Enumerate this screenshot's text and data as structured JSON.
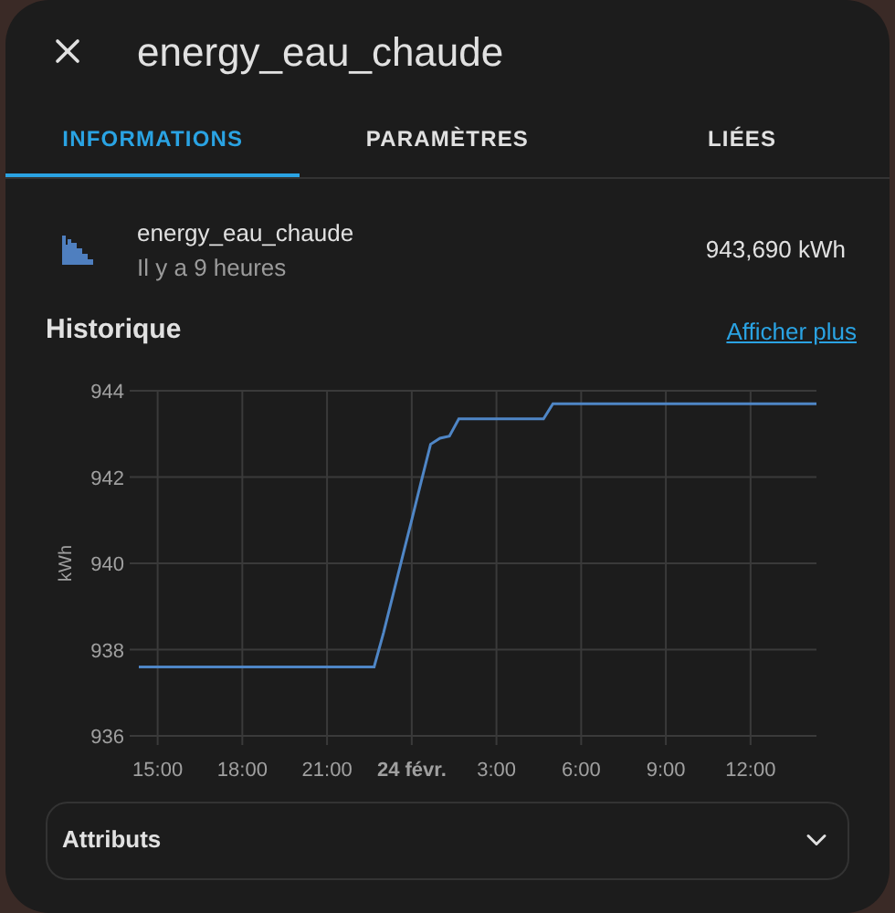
{
  "dialog": {
    "title": "energy_eau_chaude"
  },
  "tabs": [
    {
      "label": "INFORMATIONS",
      "selected": true
    },
    {
      "label": "PARAMÈTRES",
      "selected": false
    },
    {
      "label": "LIÉES",
      "selected": false
    }
  ],
  "entity": {
    "name": "energy_eau_chaude",
    "time": "Il y a 9 heures",
    "state": "943,690 kWh"
  },
  "history": {
    "title": "Historique",
    "link": "Afficher plus",
    "chart_data": {
      "type": "line",
      "ylabel": "kWh",
      "categories": [
        null,
        null,
        "15:00",
        null,
        null,
        null,
        null,
        null,
        null,
        null,
        null,
        "18:00",
        null,
        null,
        null,
        null,
        null,
        null,
        null,
        null,
        "21:00",
        null,
        null,
        null,
        null,
        null,
        null,
        null,
        null,
        "24 févr.",
        null,
        null,
        null,
        null,
        null,
        null,
        null,
        null,
        "3:00",
        null,
        null,
        null,
        null,
        null,
        null,
        null,
        null,
        "6:00",
        null,
        null,
        null,
        null,
        null,
        null,
        null,
        null,
        "9:00",
        null,
        null,
        null,
        null,
        null,
        null,
        null,
        null,
        "12:00",
        null,
        null,
        null,
        null,
        null,
        null,
        null
      ],
      "series": [
        {
          "color": "#4f86c6",
          "values": [
            937.6,
            937.6,
            937.6,
            937.6,
            937.6,
            937.6,
            937.6,
            937.6,
            937.6,
            937.6,
            937.6,
            937.6,
            937.6,
            937.6,
            937.6,
            937.6,
            937.6,
            937.6,
            937.6,
            937.6,
            937.6,
            937.6,
            937.6,
            937.6,
            937.6,
            937.6,
            938.39,
            939.26,
            940.14,
            941.01,
            941.89,
            942.76,
            942.9,
            942.95,
            943.35,
            943.35,
            943.35,
            943.35,
            943.35,
            943.35,
            943.35,
            943.35,
            943.35,
            943.35,
            943.7,
            943.7,
            943.7,
            943.7,
            943.7,
            943.7,
            943.7,
            943.7,
            943.7,
            943.7,
            943.7,
            943.7,
            943.7,
            943.7,
            943.7,
            943.7,
            943.7,
            943.7,
            943.7,
            943.7,
            943.7,
            943.7,
            943.7,
            943.7,
            943.7,
            943.7,
            943.7,
            943.7,
            943.7
          ]
        }
      ],
      "grid": true,
      "ylim": [
        936,
        944
      ],
      "yticks": [
        936,
        938,
        940,
        942,
        944
      ]
    }
  },
  "attributes": {
    "label": "Attributs",
    "expanded": false
  }
}
